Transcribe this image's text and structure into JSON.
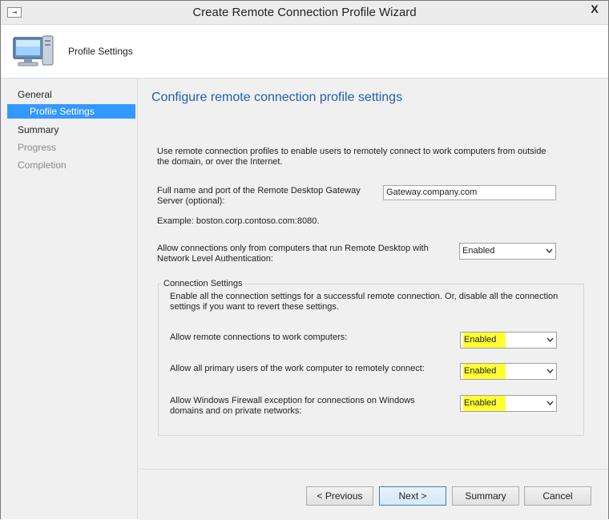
{
  "window": {
    "title": "Create Remote Connection Profile Wizard",
    "close_glyph": "X"
  },
  "header": {
    "title": "Profile Settings",
    "icon": "computer-icon"
  },
  "nav": {
    "items": [
      {
        "label": "General"
      },
      {
        "label": "Profile Settings"
      },
      {
        "label": "Summary"
      },
      {
        "label": "Progress"
      },
      {
        "label": "Completion"
      }
    ]
  },
  "main": {
    "title": "Configure remote connection profile settings",
    "intro": "Use remote connection profiles to enable users to remotely connect to work computers from outside the domain, or over the Internet.",
    "gateway": {
      "label": "Full name and port of the Remote Desktop Gateway Server (optional):",
      "value": "Gateway.company.com",
      "example": "Example: boston.corp.contoso.com:8080."
    },
    "nla": {
      "label": "Allow connections only from computers that run Remote Desktop with Network Level Authentication:",
      "value": "Enabled"
    },
    "connection_settings": {
      "legend": "Connection Settings",
      "description": "Enable all the connection settings for a successful remote connection. Or, disable all the connection settings if you want to revert these settings.",
      "remote": {
        "label": "Allow remote connections to work computers:",
        "value": "Enabled"
      },
      "primary_users": {
        "label": "Allow all primary users of the work computer to remotely connect:",
        "value": "Enabled"
      },
      "firewall": {
        "label": "Allow Windows Firewall exception for connections on Windows domains and on private networks:",
        "value": "Enabled"
      }
    }
  },
  "footer": {
    "previous": "< Previous",
    "next": "Next >",
    "summary": "Summary",
    "cancel": "Cancel"
  },
  "colors": {
    "accent_title": "#1f5fb0",
    "nav_selected": "#3399ff",
    "highlight": "#ffff33"
  }
}
